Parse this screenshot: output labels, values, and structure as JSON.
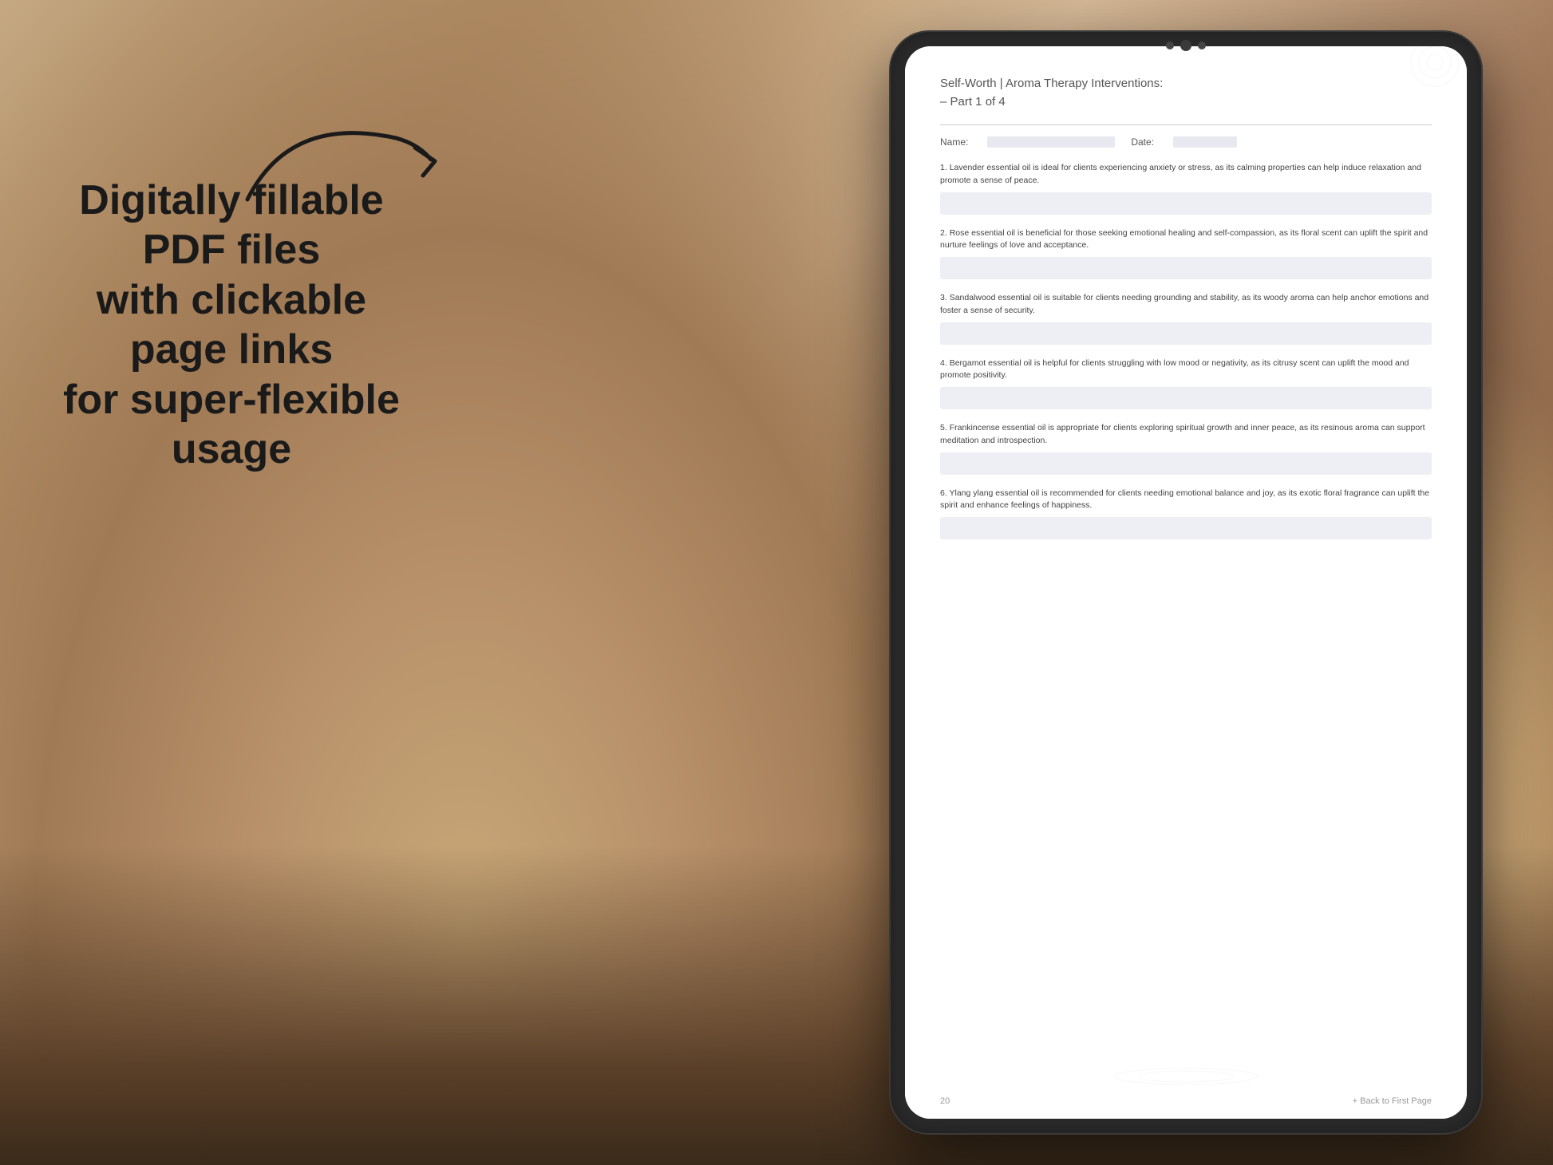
{
  "background": {
    "color_start": "#c4a882",
    "color_end": "#6b4a30"
  },
  "left_text": {
    "line1": "Digitally fillable PDF files",
    "line2": "with clickable page links",
    "line3": "for super-flexible usage"
  },
  "arrow": {
    "label": "arrow pointing right and down to tablet"
  },
  "tablet": {
    "camera_dots": 3
  },
  "pdf": {
    "title": "Self-Worth | Aroma Therapy Interventions:",
    "subtitle": "– Part 1 of 4",
    "name_label": "Name:",
    "date_label": "Date:",
    "items": [
      {
        "number": "1.",
        "text": "Lavender essential oil is ideal for clients experiencing anxiety or stress, as its calming properties can help induce relaxation and promote a sense of peace."
      },
      {
        "number": "2.",
        "text": "Rose essential oil is beneficial for those seeking emotional healing and self-compassion, as its floral scent can uplift the spirit and nurture feelings of love and acceptance."
      },
      {
        "number": "3.",
        "text": "Sandalwood essential oil is suitable for clients needing grounding and stability, as its woody aroma can help anchor emotions and foster a sense of security."
      },
      {
        "number": "4.",
        "text": "Bergamot essential oil is helpful for clients struggling with low mood or negativity, as its citrusy scent can uplift the mood and promote positivity."
      },
      {
        "number": "5.",
        "text": "Frankincense essential oil is appropriate for clients exploring spiritual growth and inner peace, as its resinous aroma can support meditation and introspection."
      },
      {
        "number": "6.",
        "text": "Ylang ylang essential oil is recommended for clients needing emotional balance and joy, as its exotic floral fragrance can uplift the spirit and enhance feelings of happiness."
      }
    ],
    "page_number": "20",
    "back_link": "+ Back to First Page"
  }
}
